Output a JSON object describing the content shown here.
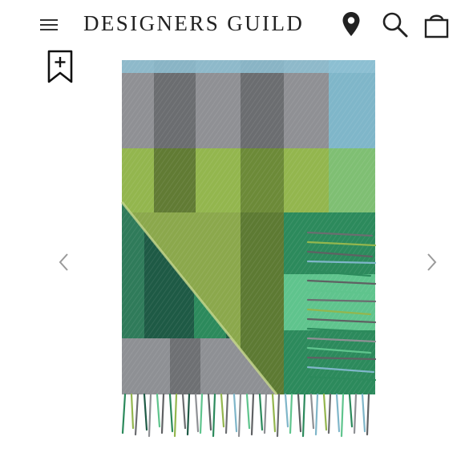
{
  "header": {
    "brand": "DESIGNERS GUILD",
    "icons": [
      "menu-icon",
      "location-pin-icon",
      "search-icon",
      "shopping-bag-icon"
    ]
  },
  "gallery": {
    "image_name": "checked-wool-throw",
    "colors": {
      "grey": "#8e8f93",
      "dark_grey": "#5f6163",
      "light_blue": "#7fb6c9",
      "lime": "#8aae44",
      "olive": "#617b34",
      "emerald": "#2c8a5c",
      "dark_green": "#1e5a45",
      "mint": "#5fc48d"
    },
    "icons": [
      "bookmark-add-icon",
      "chevron-left-icon",
      "chevron-right-icon"
    ]
  }
}
